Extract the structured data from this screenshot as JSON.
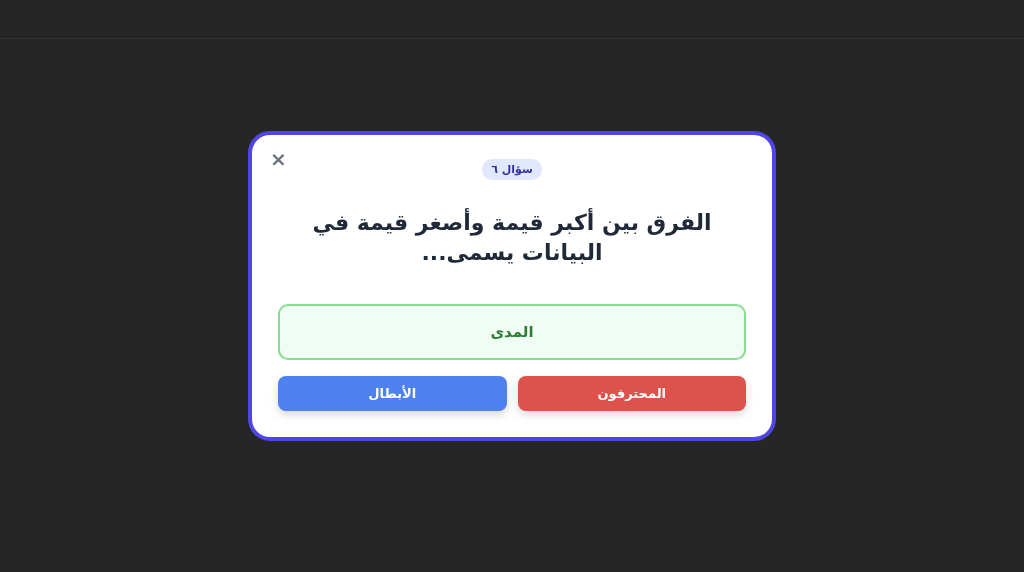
{
  "dialog": {
    "close": "×",
    "badge": "سؤال ٦",
    "question": "الفرق بين أكبر قيمة وأصغر قيمة في البيانات يسمى...",
    "answer": "المدى",
    "buttons": [
      {
        "label": "المحترفون",
        "kind": "danger"
      },
      {
        "label": "الأبطال",
        "kind": "primary"
      }
    ]
  }
}
